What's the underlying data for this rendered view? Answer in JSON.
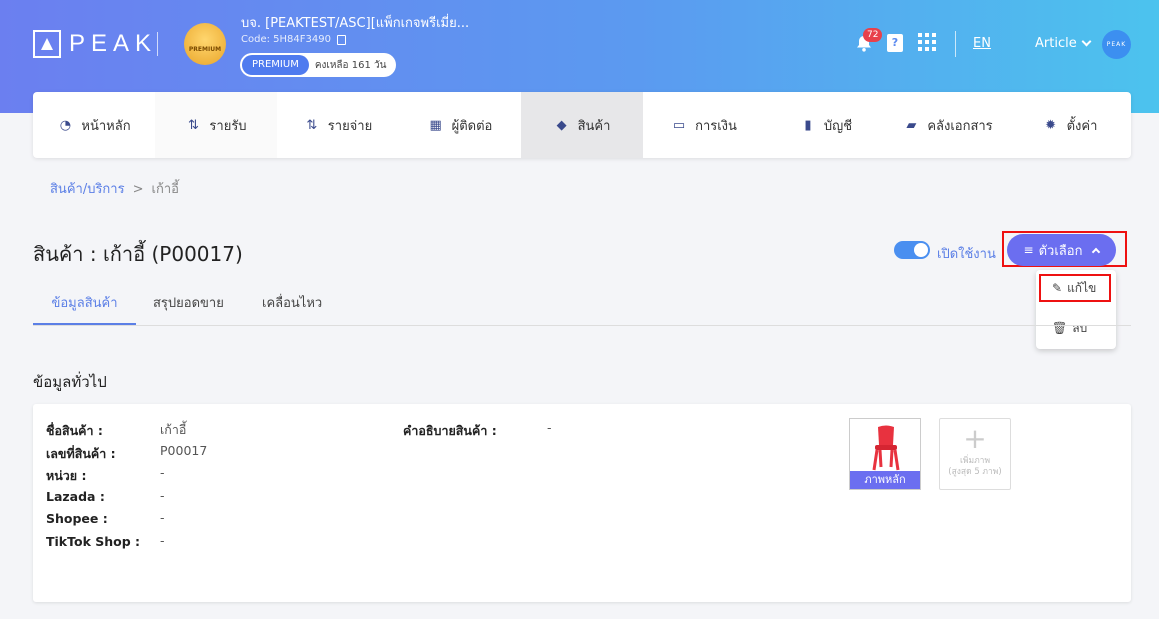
{
  "header": {
    "logo_text": "PEAK",
    "badge_text": "PREMIUM",
    "company_name": "บจ. [PEAKTEST/ASC][แพ็กเกจพรีเมี่ย...",
    "company_code": "Code: 5H84F3490",
    "plan_label": "PREMIUM",
    "plan_remaining": "คงเหลือ 161 วัน",
    "notification_count": "72",
    "help_glyph": "?",
    "language": "EN",
    "user_name": "Article",
    "user_avatar_text": "PEAK"
  },
  "nav": {
    "items": [
      {
        "label": "หน้าหลัก",
        "icon": "dashboard-icon",
        "glyph": "◔"
      },
      {
        "label": "รายรับ",
        "icon": "income-icon",
        "glyph": "⇅"
      },
      {
        "label": "รายจ่าย",
        "icon": "expense-icon",
        "glyph": "⇅"
      },
      {
        "label": "ผู้ติดต่อ",
        "icon": "contacts-icon",
        "glyph": "▦"
      },
      {
        "label": "สินค้า",
        "icon": "product-box-icon",
        "glyph": "◆"
      },
      {
        "label": "การเงิน",
        "icon": "money-icon",
        "glyph": "▭"
      },
      {
        "label": "บัญชี",
        "icon": "ledger-icon",
        "glyph": "▮"
      },
      {
        "label": "คลังเอกสาร",
        "icon": "folder-icon",
        "glyph": "▰"
      },
      {
        "label": "ตั้งค่า",
        "icon": "gear-icon",
        "glyph": "✹"
      }
    ]
  },
  "breadcrumb": {
    "parent": "สินค้า/บริการ",
    "separator": ">",
    "current": "เก้าอี้"
  },
  "page": {
    "title": "สินค้า : เก้าอี้ (P00017)",
    "toggle_label": "เปิดใช้งาน",
    "options_label": "ตัวเลือก",
    "menu_glyph": "≡"
  },
  "dropdown": {
    "edit_label": "แก้ไข",
    "edit_glyph": "✎",
    "delete_label": "ลบ",
    "delete_glyph": "🗑"
  },
  "tabs": [
    {
      "label": "ข้อมูลสินค้า"
    },
    {
      "label": "สรุปยอดขาย"
    },
    {
      "label": "เคลื่อนไหว"
    }
  ],
  "section": {
    "title": "ข้อมูลทั่วไป"
  },
  "product": {
    "fields": [
      {
        "label": "ชื่อสินค้า :",
        "value": "เก้าอี้"
      },
      {
        "label": "เลขที่สินค้า :",
        "value": "P00017"
      },
      {
        "label": "หน่วย :",
        "value": "-"
      },
      {
        "label": "Lazada :",
        "value": "-"
      },
      {
        "label": "Shopee :",
        "value": "-"
      },
      {
        "label": "TikTok Shop :",
        "value": "-"
      }
    ],
    "description_label": "คำอธิบายสินค้า :",
    "description_value": "-",
    "main_image_caption": "ภาพหลัก",
    "add_image_glyph": "+",
    "add_image_line1": "เพิ่มภาพ",
    "add_image_line2": "(สูงสุด 5 ภาพ)"
  },
  "colors": {
    "accent": "#6b6ef0",
    "link": "#5b7fe6",
    "highlight": "#e11111"
  }
}
